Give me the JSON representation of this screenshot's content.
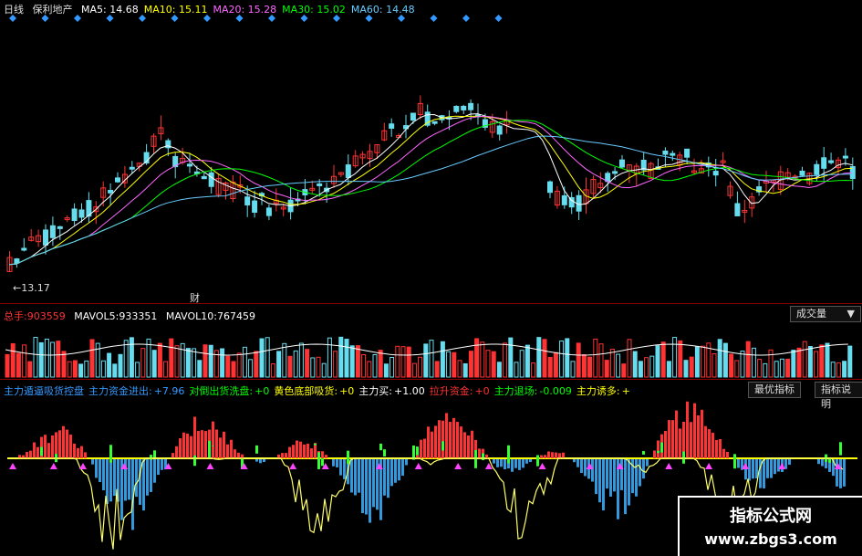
{
  "header": {
    "period": "日线",
    "stock_name": "保利地产",
    "ma": [
      {
        "label": "MA5:",
        "value": "14.68",
        "color": "#ffffff"
      },
      {
        "label": "MA10:",
        "value": "15.11",
        "color": "#ffff00"
      },
      {
        "label": "MA20:",
        "value": "15.28",
        "color": "#ff66ff"
      },
      {
        "label": "MA30:",
        "value": "15.02",
        "color": "#00ff00"
      },
      {
        "label": "MA60:",
        "value": "14.48",
        "color": "#66ccff"
      }
    ]
  },
  "price_panel": {
    "low_marker": "13.17",
    "fin_marker": "财"
  },
  "volume_panel": {
    "total_label": "总手:",
    "total_value": "903559",
    "mavol5_label": "MAVOL5:",
    "mavol5_value": "933351",
    "mavol10_label": "MAVOL10:",
    "mavol10_value": "767459",
    "dropdown_label": "成交量"
  },
  "indicator_panel": {
    "items": [
      {
        "text": "主力遁逼吸货控盘",
        "color": "#3399ff"
      },
      {
        "text": "主力资金进出:",
        "color": "#3399ff"
      },
      {
        "text": "+7.96",
        "color": "#3399ff"
      },
      {
        "text": "对倒出货洗盘:",
        "color": "#00ff00"
      },
      {
        "text": "+0",
        "color": "#00ff00"
      },
      {
        "text": "黄色底部吸货:",
        "color": "#ffff00"
      },
      {
        "text": "+0",
        "color": "#ffff00"
      },
      {
        "text": "主力买:",
        "color": "#ffffff"
      },
      {
        "text": "+1.00",
        "color": "#ffffff"
      },
      {
        "text": "拉升资金:",
        "color": "#ff3333"
      },
      {
        "text": "+0",
        "color": "#ff3333"
      },
      {
        "text": "主力退场:",
        "color": "#00ff00"
      },
      {
        "text": "-0.009",
        "color": "#00ff00"
      },
      {
        "text": "主力诱多:",
        "color": "#ffff00"
      },
      {
        "text": "+",
        "color": "#ffff00"
      }
    ],
    "btn_best": "最优指标",
    "btn_help": "指标说明"
  },
  "watermark": {
    "title": "指标公式网",
    "url": "www.zbgs3.com"
  },
  "colors": {
    "up": "#ff3333",
    "down": "#66ddee",
    "grid": "#8b0000"
  }
}
